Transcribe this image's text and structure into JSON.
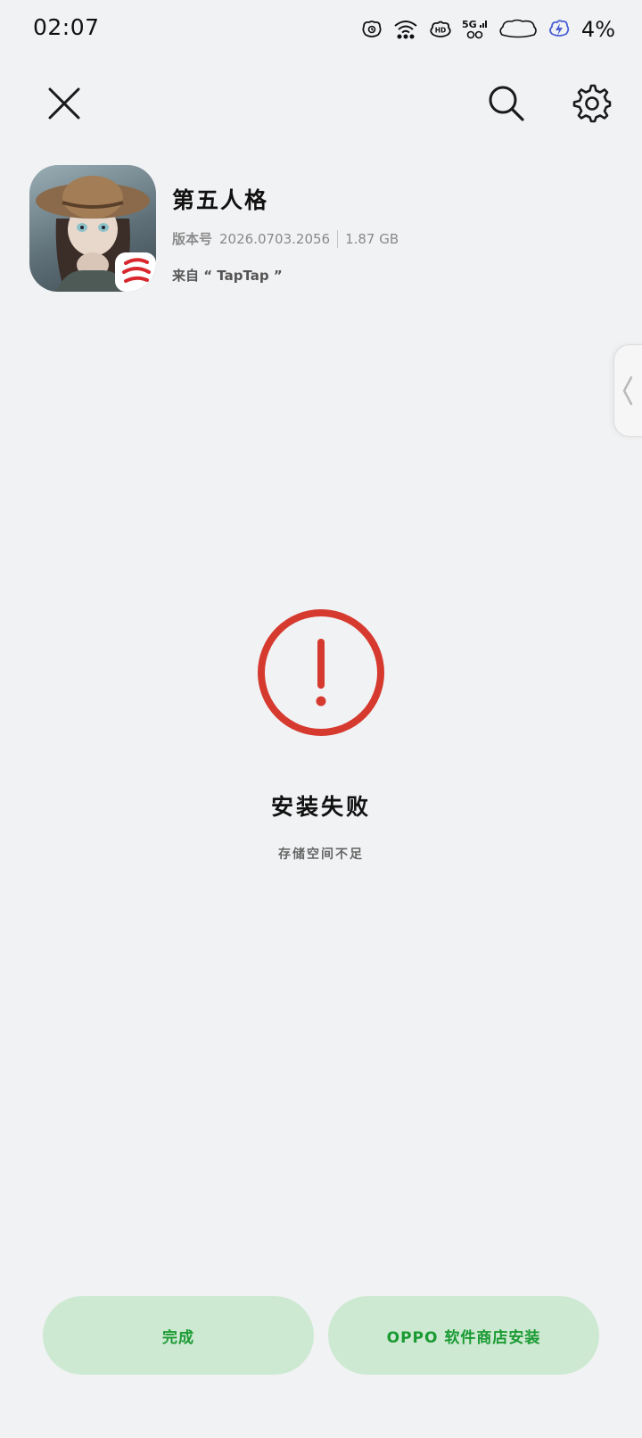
{
  "status_bar": {
    "time": "02:07",
    "battery_percent": "4%",
    "network_label": "5G",
    "hd_label": "HD"
  },
  "toolbar": {
    "close_icon": "close-icon",
    "search_icon": "search-icon",
    "settings_icon": "gear-icon"
  },
  "app": {
    "name": "第五人格",
    "version_label": "版本号",
    "version": "2026.0703.2056",
    "size": "1.87 GB",
    "source": "来自 “ TapTap ”"
  },
  "result": {
    "title": "安装失败",
    "subtitle": "存储空间不足",
    "status_color": "#d63a2f"
  },
  "buttons": {
    "done": "完成",
    "store_install": "OPPO 软件商店安装"
  },
  "colors": {
    "background": "#f1f2f4",
    "button_bg": "#cde9d1",
    "button_text": "#1a9a33",
    "error": "#d63a2f"
  }
}
